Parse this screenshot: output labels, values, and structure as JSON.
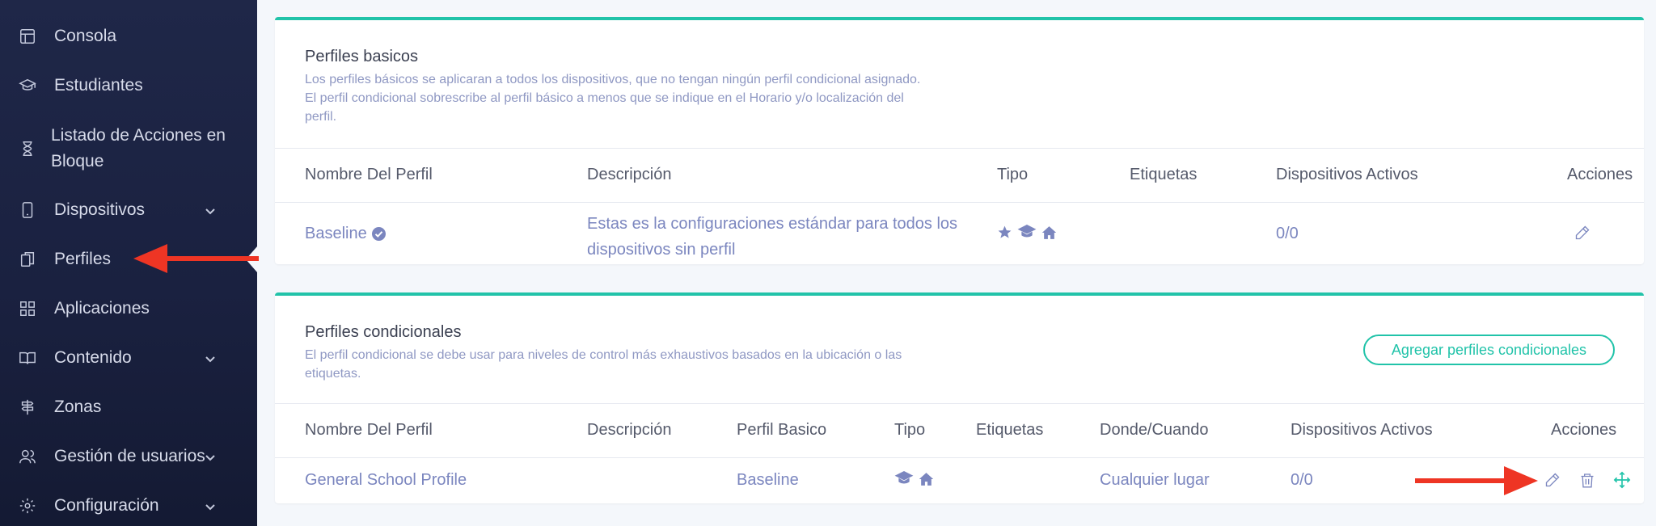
{
  "sidebar": {
    "items": [
      {
        "label": "Consola",
        "icon": "layout-icon",
        "has_chevron": false
      },
      {
        "label": "Estudiantes",
        "icon": "graduation-cap-icon",
        "has_chevron": false
      },
      {
        "label": "Listado de Acciones en Bloque",
        "icon": "hourglass-icon",
        "has_chevron": false
      },
      {
        "label": "Dispositivos",
        "icon": "tablet-icon",
        "has_chevron": true
      },
      {
        "label": "Perfiles",
        "icon": "documents-icon",
        "has_chevron": false
      },
      {
        "label": "Aplicaciones",
        "icon": "grid-icon",
        "has_chevron": false
      },
      {
        "label": "Contenido",
        "icon": "book-icon",
        "has_chevron": true
      },
      {
        "label": "Zonas",
        "icon": "signpost-icon",
        "has_chevron": false
      },
      {
        "label": "Gestión de usuarios",
        "icon": "users-icon",
        "has_chevron": true
      },
      {
        "label": "Configuración",
        "icon": "gear-icon",
        "has_chevron": true
      }
    ]
  },
  "basic": {
    "title": "Perfiles basicos",
    "desc_line1": "Los perfiles básicos se aplicaran a todos los dispositivos, que no tengan ningún perfil condicional asignado.",
    "desc_line2": "El perfil condicional sobrescribe al perfil básico a menos que se indique en el Horario y/o localización del",
    "desc_line3": "perfil.",
    "columns": {
      "name": "Nombre Del Perfil",
      "description": "Descripción",
      "type": "Tipo",
      "tags": "Etiquetas",
      "active": "Dispositivos Activos",
      "actions": "Acciones"
    },
    "row": {
      "name": "Baseline",
      "desc_line1": "Estas es la configuraciones estándar para todos los",
      "desc_line2": "dispositivos sin perfil",
      "active": "0/0"
    }
  },
  "conditional": {
    "title": "Perfiles condicionales",
    "desc_line1": "El perfil condicional se debe usar para niveles de control más exhaustivos basados en la ubicación o las",
    "desc_line2": "etiquetas.",
    "add_button": "Agregar perfiles condicionales",
    "columns": {
      "name": "Nombre Del Perfil",
      "description": "Descripción",
      "basic": "Perfil Basico",
      "type": "Tipo",
      "tags": "Etiquetas",
      "where": "Donde/Cuando",
      "active": "Dispositivos Activos",
      "actions": "Acciones"
    },
    "row": {
      "name": "General School Profile",
      "basic": "Baseline",
      "where": "Cualquier lugar",
      "active": "0/0"
    }
  },
  "colors": {
    "accent": "#21c3a9",
    "link": "#7b86bf",
    "arrow": "#ee3524",
    "sidebar_bg": "#1f2748"
  }
}
